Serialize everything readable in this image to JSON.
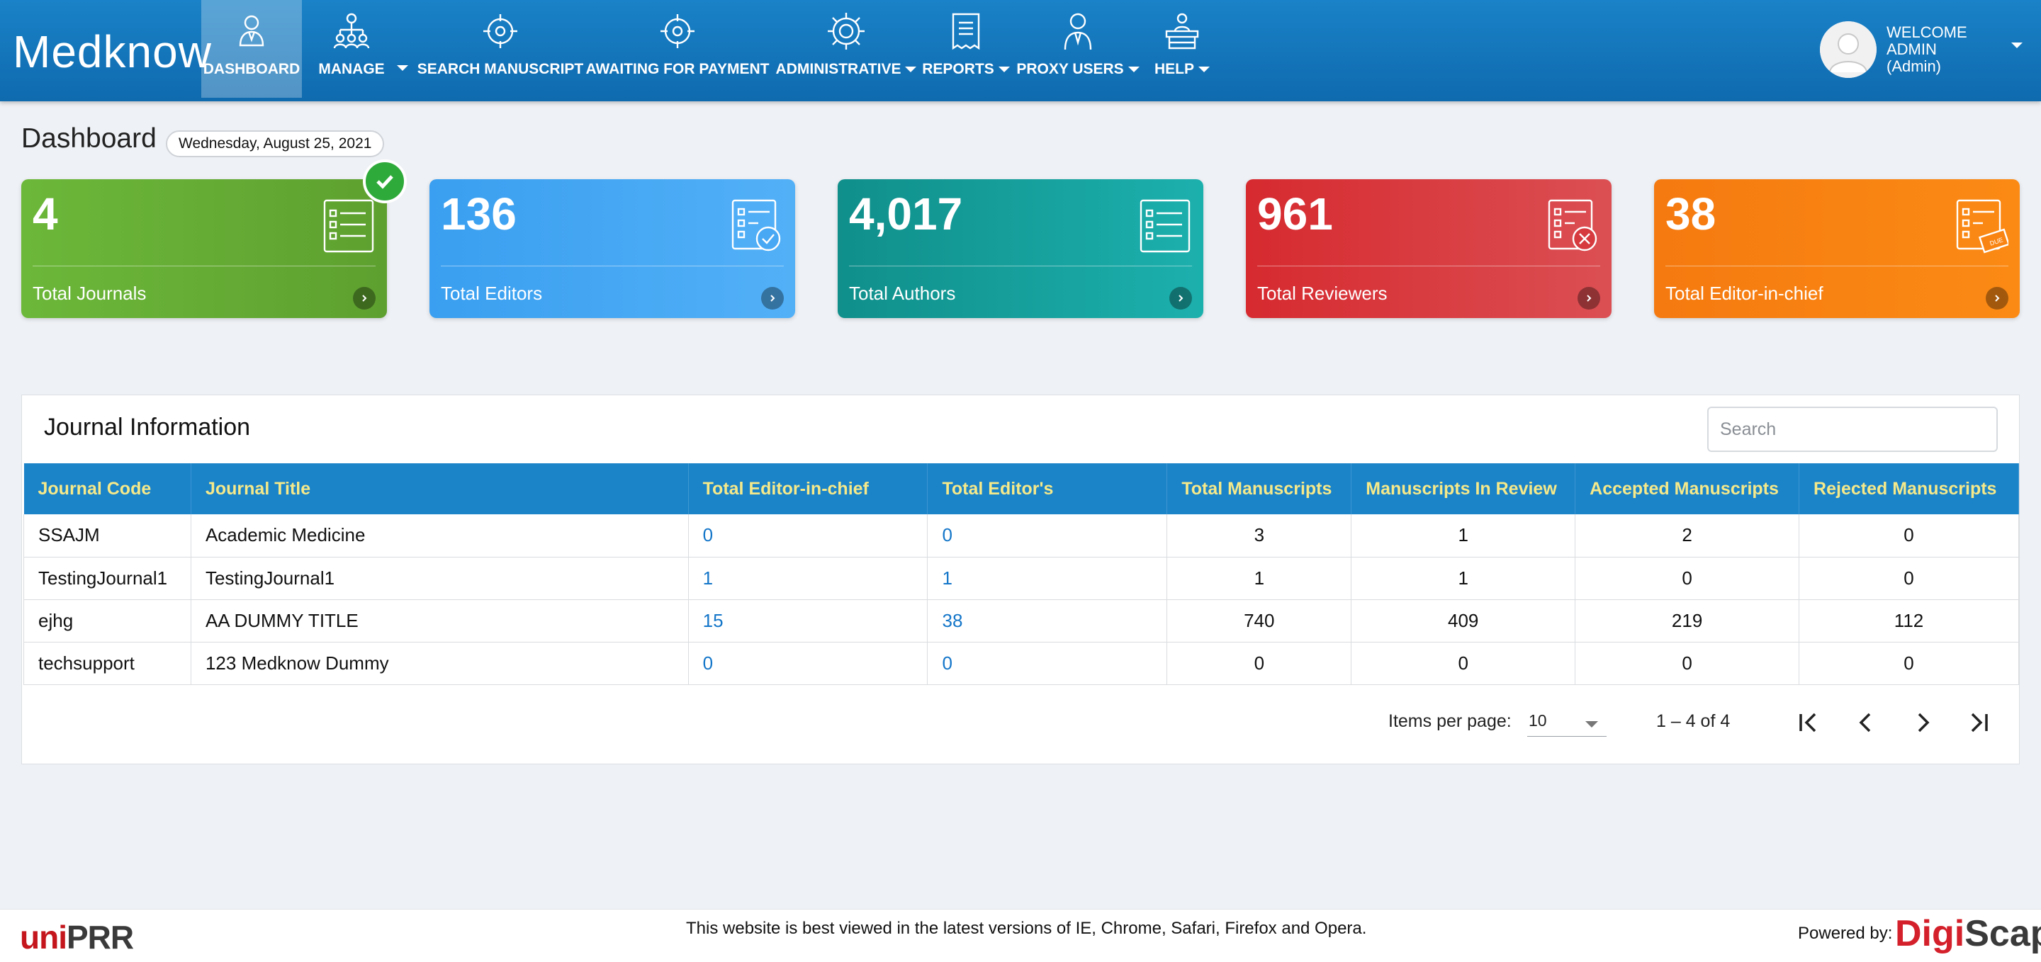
{
  "app": {
    "logo": "Medknow"
  },
  "nav": {
    "items": [
      {
        "label": "DASHBOARD",
        "icon": "dashboard-user-icon",
        "caret": false
      },
      {
        "label": "MANAGE",
        "icon": "org-chart-icon",
        "caret": true
      },
      {
        "label": "SEARCH MANUSCRIPT",
        "icon": "target-icon",
        "caret": false
      },
      {
        "label": "AWAITING FOR PAYMENT",
        "icon": "target-icon",
        "caret": false
      },
      {
        "label": "ADMINISTRATIVE",
        "icon": "gear-icon",
        "caret": true
      },
      {
        "label": "REPORTS",
        "icon": "receipt-icon",
        "caret": true
      },
      {
        "label": "PROXY USERS",
        "icon": "person-icon",
        "caret": true
      },
      {
        "label": "HELP",
        "icon": "help-desk-icon",
        "caret": true
      }
    ]
  },
  "user": {
    "line1": "WELCOME",
    "line2": "ADMIN",
    "line3": "(Admin)"
  },
  "header": {
    "title": "Dashboard",
    "date": "Wednesday, August 25, 2021"
  },
  "cards": [
    {
      "value": "4",
      "label": "Total Journals",
      "icon": "checklist-icon",
      "color": "#6cb83a"
    },
    {
      "value": "136",
      "label": "Total Editors",
      "icon": "checklist-approved-icon",
      "color": "#3a9ff0"
    },
    {
      "value": "4,017",
      "label": "Total Authors",
      "icon": "checklist-icon",
      "color": "#14a19c"
    },
    {
      "value": "961",
      "label": "Total Reviewers",
      "icon": "checklist-rejected-icon",
      "color": "#d73a3f"
    },
    {
      "value": "38",
      "label": "Total Editor-in-chief",
      "icon": "checklist-due-icon",
      "color": "#f87c12"
    }
  ],
  "panel": {
    "title": "Journal Information",
    "search_placeholder": "Search",
    "columns": [
      "Journal Code",
      "Journal Title",
      "Total Editor-in-chief",
      "Total Editor's",
      "Total Manuscripts",
      "Manuscripts In Review",
      "Accepted Manuscripts",
      "Rejected Manuscripts"
    ],
    "rows": [
      [
        "SSAJM",
        "Academic Medicine",
        "0",
        "0",
        "3",
        "1",
        "2",
        "0"
      ],
      [
        "TestingJournal1",
        "TestingJournal1",
        "1",
        "1",
        "1",
        "1",
        "0",
        "0"
      ],
      [
        "ejhg",
        "AA DUMMY TITLE",
        "15",
        "38",
        "740",
        "409",
        "219",
        "112"
      ],
      [
        "techsupport",
        "123 Medknow Dummy",
        "0",
        "0",
        "0",
        "0",
        "0",
        "0"
      ]
    ],
    "pager": {
      "items_label": "Items per page:",
      "items_value": "10",
      "range": "1 – 4 of 4"
    }
  },
  "footer": {
    "brand_a": "uni",
    "brand_b": "PRR",
    "note": "This website is best viewed in the latest versions of IE, Chrome, Safari, Firefox and Opera.",
    "powered": "Powered by:",
    "vendor_a": "Digi",
    "vendor_b": "Scape"
  }
}
